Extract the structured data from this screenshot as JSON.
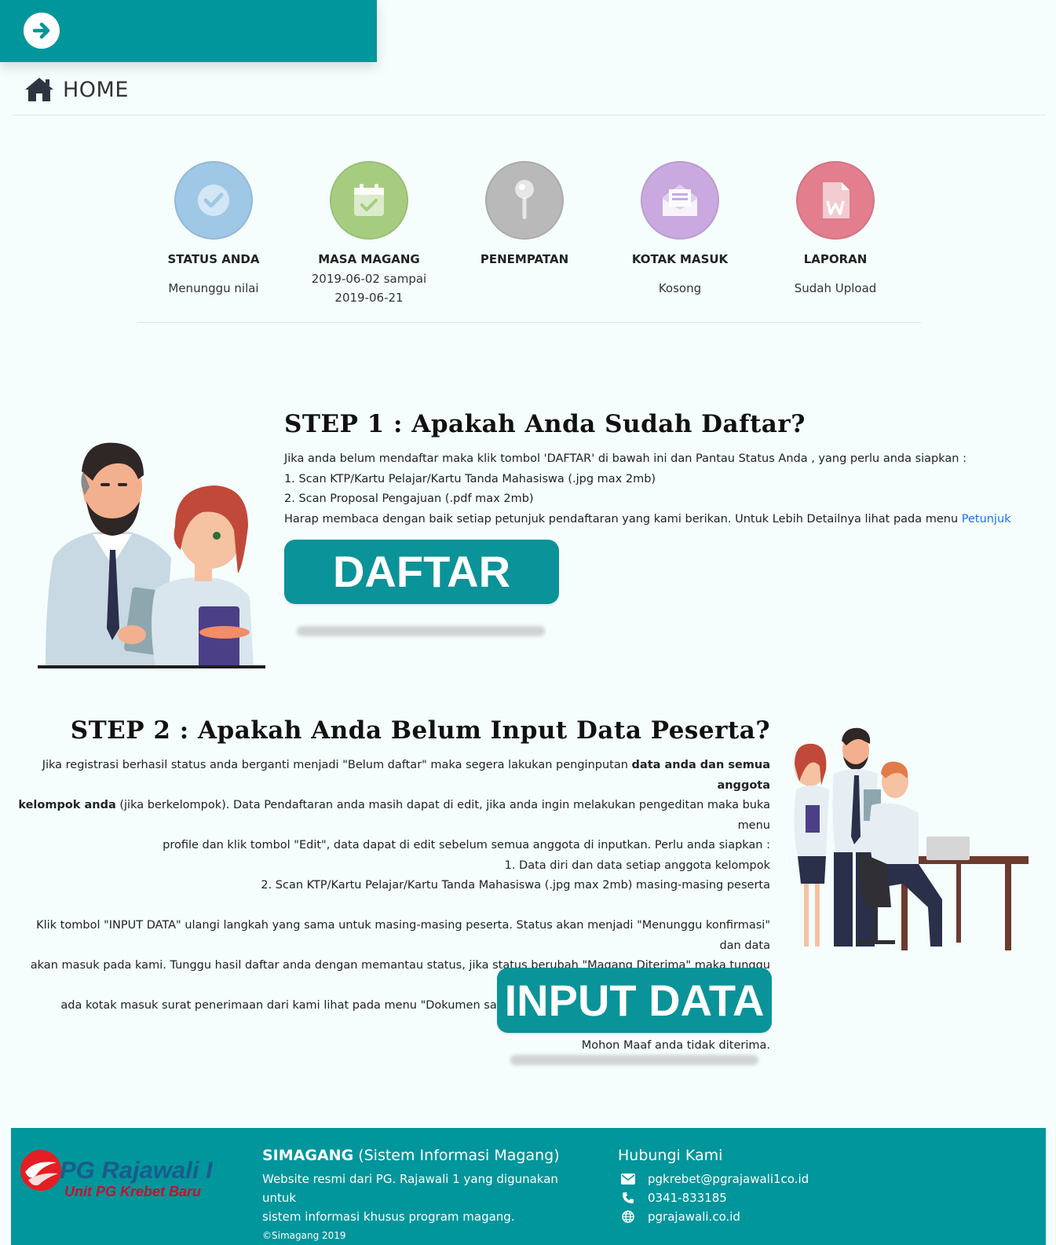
{
  "header": {
    "page_title": "HOME"
  },
  "status_cards": [
    {
      "label": "STATUS ANDA",
      "value": "Menunggu nilai",
      "color": "#9fc8e6",
      "icon": "check-circle-icon"
    },
    {
      "label": "MASA MAGANG",
      "value_line1": "2019-06-02 sampai",
      "value_line2": "2019-06-21",
      "color": "#a6cd7f",
      "icon": "calendar-check-icon"
    },
    {
      "label": "PENEMPATAN",
      "value": "",
      "color": "#b9b9b9",
      "icon": "map-pin-icon"
    },
    {
      "label": "KOTAK MASUK",
      "value": "Kosong",
      "color": "#c9a9e0",
      "icon": "envelope-open-icon"
    },
    {
      "label": "LAPORAN",
      "value": "Sudah Upload",
      "color": "#e27e8d",
      "icon": "word-file-icon"
    }
  ],
  "step1": {
    "title": "STEP 1 : Apakah Anda Sudah Daftar?",
    "line1": "Jika anda belum mendaftar maka klik tombol 'DAFTAR' di bawah ini dan Pantau Status Anda , yang perlu anda siapkan :",
    "line2": "1. Scan KTP/Kartu Pelajar/Kartu Tanda Mahasiswa (.jpg max 2mb)",
    "line3": "2. Scan Proposal Pengajuan (.pdf max 2mb)",
    "line4": "Harap membaca dengan baik setiap petunjuk pendaftaran yang kami berikan. Untuk Lebih Detailnya lihat pada menu ",
    "link": "Petunjuk",
    "button": "DAFTAR"
  },
  "step2": {
    "title": "STEP 2 : Apakah Anda Belum Input Data Peserta?",
    "p1_a": "Jika registrasi berhasil status anda berganti menjadi \"Belum daftar\" maka segera lakukan penginputan ",
    "p1_b": "data anda dan semua anggota",
    "p1_c": "kelompok anda",
    "p1_d": " (jika berkelompok). Data Pendaftaran anda masih dapat di edit, jika anda ingin melakukan pengeditan maka buka menu",
    "p1_e": "profile dan klik tombol \"Edit\", data dapat di edit sebelum semua anggota di inputkan. Perlu anda siapkan :",
    "item1": "1. Data diri dan data setiap anggota kelompok",
    "item2": "2. Scan KTP/Kartu Pelajar/Kartu Tanda Mahasiswa (.jpg max 2mb) masing-masing peserta",
    "p2_l1": "Klik tombol \"INPUT DATA\" ulangi langkah yang sama untuk masing-masing peserta. Status akan menjadi \"Menunggu konfirmasi\" dan data",
    "p2_l2": "akan masuk pada kami. Tunggu hasil daftar anda dengan memantau status, jika status berubah \"Magang Diterima\" maka tunggu hingga",
    "p2_l3": "ada kotak masuk surat penerimaan dari kami lihat pada menu \"Dokumen saya\" klik \"Surat ACC\". Namun,jika status menjadi \"Ditolak\"",
    "p2_l4": "Mohon Maaf anda tidak diterima.",
    "button": "INPUT DATA"
  },
  "footer": {
    "logo_text": "PG Rajawali I",
    "logo_sub": "Unit PG Krebet Baru",
    "brand": "SIMAGANG",
    "brand_full": " (Sistem Informasi Magang)",
    "desc_line1": "Website resmi dari PG. Rajawali 1 yang digunakan untuk",
    "desc_line2": "sistem informasi khusus program magang.",
    "copyright": "©Simagang 2019",
    "contact_title": "Hubungi Kami",
    "email": "pgkrebet@pgrajawali1co.id",
    "phone": "0341-833185",
    "website": "pgrajawali.co.id"
  },
  "colors": {
    "primary": "#00969b",
    "button": "#0a9398",
    "background": "#f5fdfd"
  }
}
